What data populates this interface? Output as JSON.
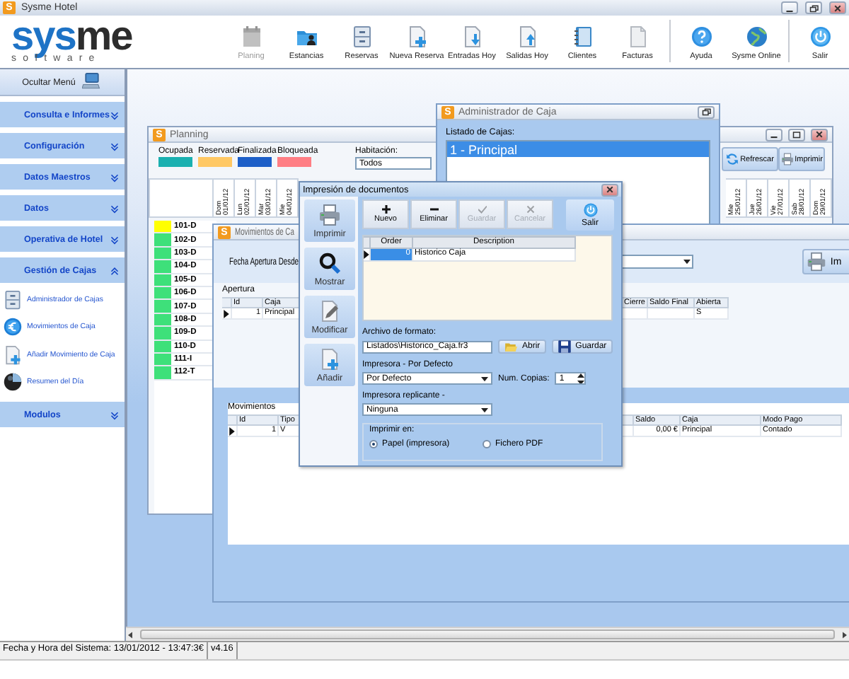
{
  "window": {
    "icon_letter": "S",
    "title": "Sysme Hotel"
  },
  "logo": {
    "parts": [
      {
        "text": "sys",
        "color": "#1e73c6"
      },
      {
        "text": "me",
        "color": "#2d2d2d"
      }
    ],
    "tagline": "software"
  },
  "toolbar": {
    "groups": [
      {
        "buttons": [
          {
            "label": "Planing",
            "disabled": true
          },
          {
            "label": "Estancias",
            "disabled": false
          },
          {
            "label": "Reservas",
            "disabled": false
          },
          {
            "label": "Nueva Reserva",
            "disabled": false
          },
          {
            "label": "Entradas Hoy",
            "disabled": false
          },
          {
            "label": "Salidas Hoy",
            "disabled": false
          },
          {
            "label": "Clientes",
            "disabled": false
          },
          {
            "label": "Facturas",
            "disabled": false
          }
        ]
      },
      {
        "buttons": [
          {
            "label": "Ayuda",
            "disabled": false
          },
          {
            "label": "Sysme Online",
            "disabled": false
          }
        ]
      },
      {
        "buttons": [
          {
            "label": "Salir",
            "disabled": false
          }
        ]
      }
    ]
  },
  "sidebar": {
    "hide_menu": "Ocultar Menú",
    "sections": [
      {
        "label": "Consulta e Informes",
        "expanded": false
      },
      {
        "label": "Configuración",
        "expanded": false
      },
      {
        "label": "Datos Maestros",
        "expanded": false
      },
      {
        "label": "Datos",
        "expanded": false
      },
      {
        "label": "Operativa de Hotel",
        "expanded": false
      },
      {
        "label": "Gestión de Cajas",
        "expanded": true,
        "items": [
          "Administrador de Cajas",
          "Movimientos de Caja",
          "Añadir Movimiento de Caja",
          "Resumen del Día"
        ]
      },
      {
        "label": "Modulos",
        "expanded": false
      }
    ]
  },
  "planning": {
    "icon_letter": "S",
    "title": "Planning",
    "legend": [
      {
        "label": "Ocupada",
        "color": "#1ab0b0"
      },
      {
        "label": "Reservada",
        "color": "#ffc864"
      },
      {
        "label": "Finalizada",
        "color": "#1d5fc8"
      },
      {
        "label": "Bloqueada",
        "color": "#ff7e84"
      }
    ],
    "room_filter": {
      "label": "Habitación:",
      "value": "Todos"
    },
    "buttons": [
      "Refrescar",
      "Imprimir"
    ],
    "dates_left": [
      "Dom 01/01/12",
      "Lun 02/01/12",
      "Mar 03/01/12",
      "Mie 04/01/12"
    ],
    "dates_right": [
      "Mie 25/01/12",
      "Jue 26/01/12",
      "Vie 27/01/12",
      "Sab 28/01/12",
      "Dom 29/01/12"
    ],
    "rooms": [
      {
        "label": "101-D",
        "color": "#ffff00"
      },
      {
        "label": "102-D",
        "color": "#3ee07a"
      },
      {
        "label": "103-D",
        "color": "#3ee07a"
      },
      {
        "label": "104-D",
        "color": "#3ee07a"
      },
      {
        "label": "105-D",
        "color": "#3ee07a"
      },
      {
        "label": "106-D",
        "color": "#3ee07a"
      },
      {
        "label": "107-D",
        "color": "#3ee07a"
      },
      {
        "label": "108-D",
        "color": "#3ee07a"
      },
      {
        "label": "109-D",
        "color": "#3ee07a"
      },
      {
        "label": "110-D",
        "color": "#3ee07a"
      },
      {
        "label": "111-I",
        "color": "#3ee07a"
      },
      {
        "label": "112-T",
        "color": "#3ee07a"
      }
    ]
  },
  "cash_admin": {
    "icon_letter": "S",
    "title": "Administrador de Caja",
    "list_label": "Listado de Cajas:",
    "items": [
      {
        "label": "1 - Principal",
        "selected": true
      }
    ]
  },
  "cash_movements": {
    "icon_letter": "S",
    "title": "Movimientos de Ca",
    "date_label": "Fecha Apertura Desde",
    "print_button": "Im",
    "opening": {
      "label": "Apertura",
      "columns_left": [
        "Id",
        "Caja"
      ],
      "columns_right": [
        "Cierre",
        "Saldo Final",
        "Abierta"
      ],
      "rows": [
        {
          "id": "1",
          "caja": "Principal",
          "abierta": "S",
          "selected": true
        }
      ]
    },
    "movements": {
      "label": "Movimientos",
      "columns_left": [
        "Id",
        "Tipo"
      ],
      "columns_right": [
        "Saldo",
        "Caja",
        "Modo Pago"
      ],
      "rows": [
        {
          "id": "1",
          "tipo": "V",
          "saldo": "0,00 €",
          "caja": "Principal",
          "modo_pago": "Contado",
          "selected": true
        }
      ]
    }
  },
  "print_dialog": {
    "title": "Impresión de documentos",
    "side_buttons": [
      "Imprimir",
      "Mostrar",
      "Modificar",
      "Añadir"
    ],
    "actions": [
      {
        "label": "Nuevo",
        "disabled": false
      },
      {
        "label": "Eliminar",
        "disabled": false
      },
      {
        "label": "Guardar",
        "disabled": true
      },
      {
        "label": "Cancelar",
        "disabled": true
      }
    ],
    "exit_button": "Salir",
    "grid": {
      "columns": [
        "Order",
        "Description"
      ],
      "rows": [
        {
          "order": "0",
          "description": "Historico Caja",
          "selected": true
        }
      ]
    },
    "format_file": {
      "label": "Archivo de formato:",
      "value": "Listados\\Historico_Caja.fr3"
    },
    "open_button": "Abrir",
    "save_button": "Guardar",
    "printer": {
      "label": "Impresora - Por Defecto",
      "value": "Por Defecto"
    },
    "copies": {
      "label": "Num. Copias:",
      "value": "1"
    },
    "replica_printer": {
      "label": "Impresora replicante -",
      "value": "Ninguna"
    },
    "output": {
      "label": "Imprimir en:",
      "options": [
        {
          "label": "Papel (impresora)",
          "selected": true
        },
        {
          "label": "Fichero PDF",
          "selected": false
        }
      ]
    }
  },
  "status_bar": {
    "datetime": "Fecha y Hora del Sistema: 13/01/2012 - 13:47:3€",
    "version": "v4.16"
  }
}
